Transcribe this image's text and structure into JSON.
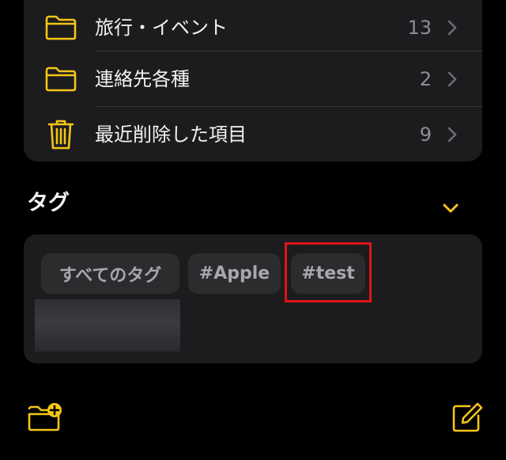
{
  "folders": [
    {
      "label": "旅行・イベント",
      "count": "13",
      "icon": "folder-icon"
    },
    {
      "label": "連絡先各種",
      "count": "2",
      "icon": "folder-icon"
    },
    {
      "label": "最近削除した項目",
      "count": "9",
      "icon": "trash-icon"
    }
  ],
  "tags_section": {
    "title": "タグ",
    "chips": [
      {
        "label": "すべてのタグ"
      },
      {
        "label": "#Apple"
      },
      {
        "label": "#test"
      }
    ]
  },
  "toolbar": {
    "new_folder_icon": "folder-plus-icon",
    "compose_icon": "compose-icon"
  },
  "colors": {
    "accent": "#f5c518",
    "background": "#000000",
    "card": "#1c1c1e",
    "chip": "#2c2c2e",
    "highlight": "#e0141b"
  }
}
